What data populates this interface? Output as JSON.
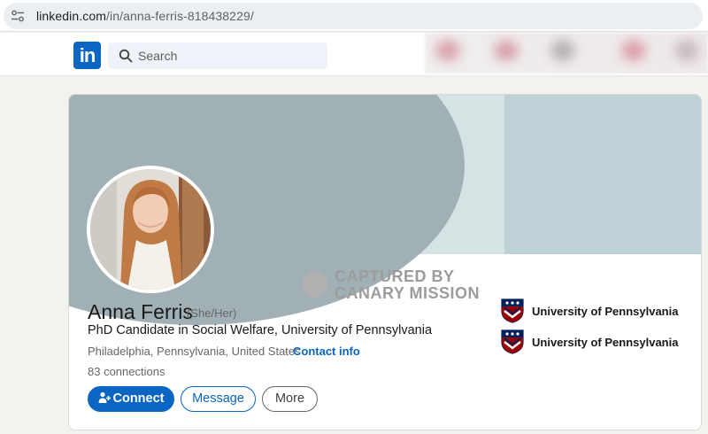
{
  "browser": {
    "url_host": "linkedin.com",
    "url_path": "/in/anna-ferris-818438229/"
  },
  "nav": {
    "logo_text": "in",
    "search_placeholder": "Search"
  },
  "watermark": {
    "line1": "CAPTURED BY",
    "line2": "CANARY MISSION"
  },
  "profile": {
    "name": "Anna Ferris",
    "pronouns": "(She/Her)",
    "headline": "PhD Candidate in Social Welfare, University of Pennsylvania",
    "location": "Philadelphia, Pennsylvania, United States",
    "separator": "·",
    "contact_label": "Contact info",
    "connections": "83 connections"
  },
  "actions": {
    "connect_label": "Connect",
    "message_label": "Message",
    "more_label": "More"
  },
  "education": [
    {
      "label": "University of Pennsylvania"
    },
    {
      "label": "University of Pennsylvania"
    }
  ],
  "colors": {
    "linkedin_blue": "#0a66c2",
    "penn_blue": "#011f5b",
    "penn_red": "#990000"
  }
}
